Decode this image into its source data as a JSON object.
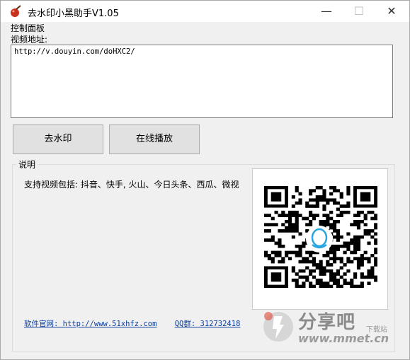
{
  "window": {
    "title": "去水印小黑助手V1.05",
    "min_glyph": "—",
    "max_glyph": "☐",
    "close_glyph": "✕"
  },
  "panel": {
    "group_label": "控制面板",
    "url_label": "视频地址:",
    "url_value": "http://v.douyin.com/doHXC2/"
  },
  "buttons": {
    "remove_watermark": "去水印",
    "play_online": "在线播放"
  },
  "info": {
    "legend": "说明",
    "support_text": "支持视频包括: 抖音、快手, 火山、今日头条、西瓜、微视",
    "website_link": "软件官网: http://www.51xhfz.com",
    "qq_group": "QQ群: 312732418"
  },
  "watermark": {
    "brand": "分享吧",
    "sub": "下载站",
    "site": "www.mmet.cn"
  },
  "colors": {
    "link": "#0b3e9e",
    "background": "#f0f0f0"
  }
}
